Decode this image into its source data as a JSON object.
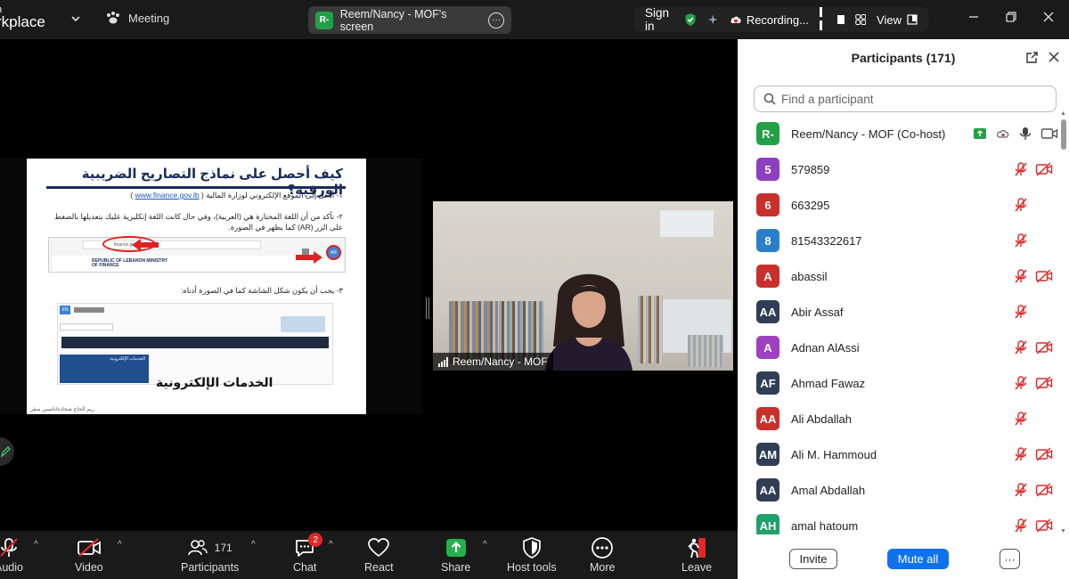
{
  "topbar": {
    "app_line1": "n",
    "app_line2": "rkplace",
    "meeting_label": "Meeting",
    "screen_share_avatar": "R-",
    "screen_share_label": "Reem/Nancy - MOF's screen",
    "sign_in": "Sign in",
    "recording_label": "Recording...",
    "view_label": "View"
  },
  "slide": {
    "title": "كيف أحصل على نماذج التصاريح الضريبية الورقية؟",
    "step1_text": "١- أدخل إلى الموقع الإلكتروني لوزارة المالية (",
    "step1_link": "www.finance.gov.lb",
    "step1_end": ")",
    "step2_text": "٢- تأكد من أن اللغة المختارة هي (العربية)، وفي حال كانت اللغة إنكليزية عليك بتعديلها بالضغط على الزر (AR) كما يظهر في الصورة.",
    "browser_url": "finance.gov.lb/en",
    "ministry_text": "REPUBLIC OF LEBANON MINISTRY OF FINANCE",
    "ar_button": "AR",
    "step3_text": "٣- يجب أن يكون شكل الشاشة كما في الصورة أدناه:",
    "site_lang": "EN",
    "panel_label": "الخدمات الإلكترونية",
    "big_text": "الخدمات الإلكترونية",
    "footer": "ريم الحاج شحادة/نانسي صقر"
  },
  "camera": {
    "name": "Reem/Nancy - MOF"
  },
  "toolbar": {
    "audio": "Audio",
    "video": "Video",
    "participants": "Participants",
    "participants_count": "171",
    "chat": "Chat",
    "chat_badge": "2",
    "react": "React",
    "share": "Share",
    "host_tools": "Host tools",
    "more": "More",
    "leave": "Leave"
  },
  "panel": {
    "title": "Participants (171)",
    "search_placeholder": "Find a participant",
    "invite": "Invite",
    "mute_all": "Mute all",
    "participants": [
      {
        "initials": "R-",
        "name": "Reem/Nancy - MOF (Co-host)",
        "color": "#22a046",
        "icons": "host"
      },
      {
        "initials": "5",
        "name": "579859",
        "color": "#8e3fbf",
        "icons": "both"
      },
      {
        "initials": "6",
        "name": "663295",
        "color": "#c9302c",
        "icons": "mic"
      },
      {
        "initials": "8",
        "name": "81543322617",
        "color": "#2b7fc9",
        "icons": "mic"
      },
      {
        "initials": "A",
        "name": "abassil",
        "color": "#c9302c",
        "icons": "both"
      },
      {
        "initials": "AA",
        "name": "Abir Assaf",
        "color": "#2f3e55",
        "icons": "mic"
      },
      {
        "initials": "A",
        "name": "Adnan AlAssi",
        "color": "#a03fbf",
        "icons": "both"
      },
      {
        "initials": "AF",
        "name": "Ahmad Fawaz",
        "color": "#2f3e55",
        "icons": "both"
      },
      {
        "initials": "AA",
        "name": "Ali Abdallah",
        "color": "#c9302c",
        "icons": "mic"
      },
      {
        "initials": "AM",
        "name": "Ali M. Hammoud",
        "color": "#2f3e55",
        "icons": "both"
      },
      {
        "initials": "AA",
        "name": "Amal Abdallah",
        "color": "#2f3e55",
        "icons": "both"
      },
      {
        "initials": "AH",
        "name": "amal hatoum",
        "color": "#22a06b",
        "icons": "both"
      }
    ]
  },
  "colors": {
    "accent": "#0e72ed",
    "mute_red": "#e02828",
    "shield_green": "#22a046"
  }
}
